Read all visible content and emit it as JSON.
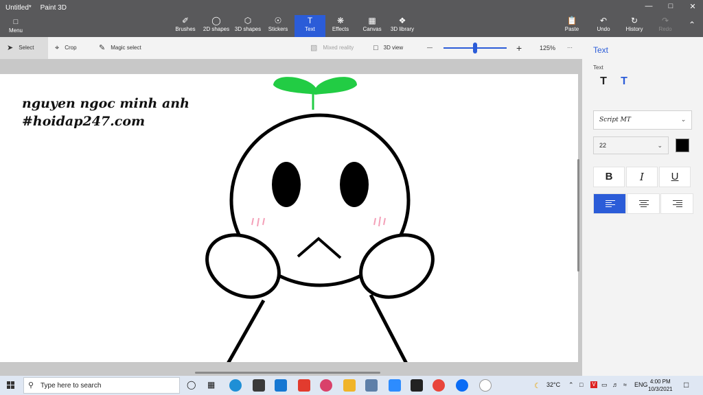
{
  "window": {
    "title": "Untitled*",
    "app_name": "Paint 3D",
    "minimize_icon": "minimize-icon",
    "maximize_icon": "maximize-icon",
    "close_icon": "close-icon"
  },
  "ribbon": {
    "menu_label": "Menu",
    "tools": [
      {
        "label": "Brushes",
        "icon": "brush-icon"
      },
      {
        "label": "2D shapes",
        "icon": "2d-shapes-icon"
      },
      {
        "label": "3D shapes",
        "icon": "3d-shapes-icon"
      },
      {
        "label": "Stickers",
        "icon": "stickers-icon"
      },
      {
        "label": "Text",
        "icon": "text-icon",
        "active": true
      },
      {
        "label": "Effects",
        "icon": "effects-icon"
      },
      {
        "label": "Canvas",
        "icon": "canvas-icon"
      },
      {
        "label": "3D library",
        "icon": "3d-library-icon"
      }
    ],
    "paste_label": "Paste",
    "undo_label": "Undo",
    "history_label": "History",
    "redo_label": "Redo"
  },
  "toolbar": {
    "select_label": "Select",
    "crop_label": "Crop",
    "magic_select_label": "Magic select",
    "mixed_reality_label": "Mixed reality",
    "view_3d_label": "3D view",
    "zoom_out_symbol": "—",
    "zoom_in_symbol": "+",
    "zoom_level": "125%",
    "zoom_fraction": 0.5,
    "more_symbol": "···"
  },
  "canvas": {
    "text_line1": "nguyen ngoc minh anh",
    "text_line2": "#hoidap247.com",
    "leaf_color": "#22cc44",
    "blush_color": "#f4a0b8"
  },
  "panel": {
    "title": "Text",
    "subtitle": "Text",
    "font_name": "Script MT",
    "font_size": "22",
    "text_color": "#000000",
    "bold_label": "B",
    "italic_label": "I",
    "underline_label": "U",
    "accent_color": "#2b5cd8"
  },
  "taskbar": {
    "search_placeholder": "Type here to search",
    "weather": "32°C",
    "language": "ENG",
    "time": "4:00 PM",
    "date": "10/3/2021"
  }
}
